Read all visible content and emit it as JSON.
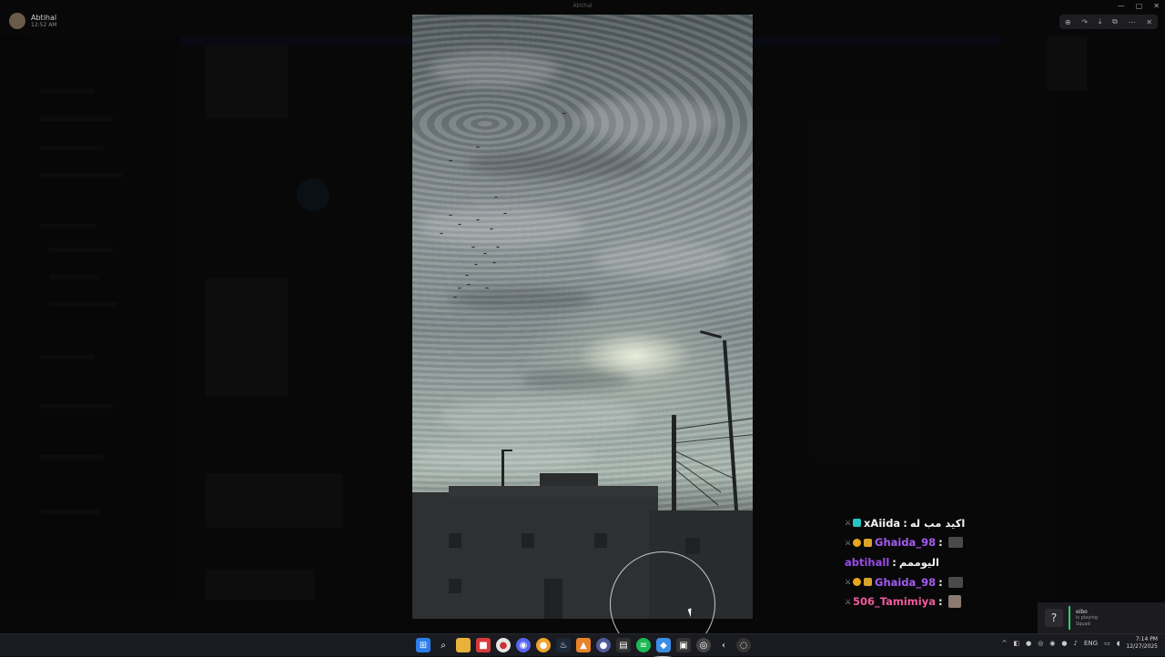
{
  "app": {
    "window_title": "Abtihal"
  },
  "user": {
    "name": "Abtihal",
    "time": "12:52 AM"
  },
  "viewer_toolbar": {
    "icons": [
      "zoom-icon",
      "forward-icon",
      "download-icon",
      "open-external-icon",
      "more-icon",
      "close-icon"
    ]
  },
  "chat": [
    {
      "username": "xAiida",
      "text": "اكيد مب له",
      "color": "#f2f2f2",
      "badges": [
        "sword",
        "cyan"
      ],
      "emote": false
    },
    {
      "username": "Ghaida_98",
      "text": "",
      "color": "#a35cf2",
      "badges": [
        "sword",
        "gold",
        "crown"
      ],
      "emote": true
    },
    {
      "username": "abtihall",
      "text": "اليوممم",
      "color": "#9b4ce8",
      "badges": [],
      "emote": false
    },
    {
      "username": "Ghaida_98",
      "text": "",
      "color": "#a35cf2",
      "badges": [
        "sword",
        "gold",
        "crown"
      ],
      "emote": true
    },
    {
      "username": "506_Tamimiya",
      "text": "",
      "color": "#f05a9b",
      "badges": [
        "sword"
      ],
      "emote": true
    }
  ],
  "chat_separator": ":",
  "playing": {
    "name": "eibo",
    "status": "is playing",
    "game": "Squad"
  },
  "tray": {
    "language": "ENG",
    "time": "7:14 PM",
    "date": "12/27/2025"
  },
  "taskbar_icons": [
    "start-icon",
    "search-icon",
    "file-explorer-icon",
    "app-red-icon",
    "chrome-icon",
    "discord-icon",
    "browser-icon",
    "steam-icon",
    "app-blue-icon",
    "terminal-icon",
    "spotify-icon",
    "app-cyan-icon",
    "app-dark-icon",
    "app-red-circle-icon",
    "back-icon",
    "obs-icon"
  ],
  "viewer_circle_highlight": true
}
